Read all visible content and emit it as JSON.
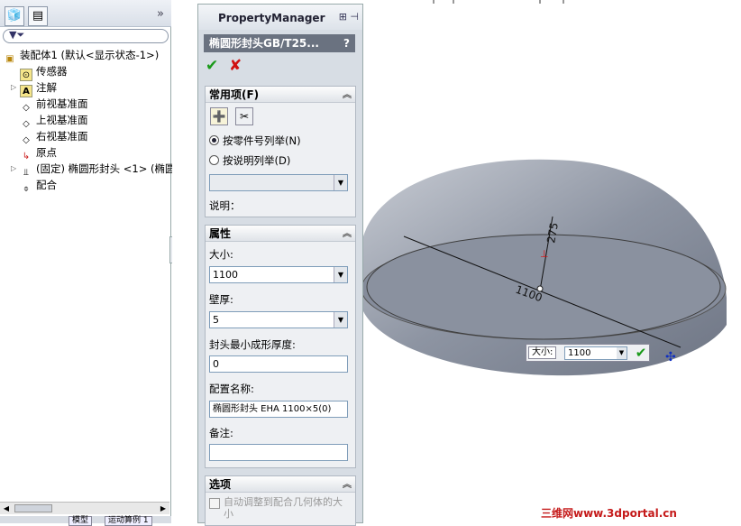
{
  "tree": {
    "filter_icon": "filter-icon",
    "collapse_label": "»",
    "items": [
      {
        "label": "装配体1 (默认<显示状态-1>)",
        "icon": "assembly-icon"
      },
      {
        "label": "传感器",
        "icon": "sensor-icon"
      },
      {
        "label": "注解",
        "icon": "annotation-icon"
      },
      {
        "label": "前视基准面",
        "icon": "plane-icon"
      },
      {
        "label": "上视基准面",
        "icon": "plane-icon"
      },
      {
        "label": "右视基准面",
        "icon": "plane-icon"
      },
      {
        "label": "原点",
        "icon": "origin-icon"
      },
      {
        "label": "(固定) 椭圆形封头 <1> (椭圆",
        "icon": "part-icon"
      },
      {
        "label": "配合",
        "icon": "mate-icon"
      }
    ],
    "bottom_tabs": [
      "模型",
      "运动算例 1"
    ]
  },
  "pm": {
    "title": "PropertyManager",
    "feature_name": "椭圆形封头GB/T25...",
    "help": "?",
    "groups": {
      "common": {
        "title": "常用项(F)",
        "radio1": "按零件号列举(N)",
        "radio2": "按说明列举(D)",
        "desc_label": "说明："
      },
      "props": {
        "title": "属性",
        "size_label": "大小:",
        "size_value": "1100",
        "thickness_label": "壁厚:",
        "thickness_value": "5",
        "min_thick_label": "封头最小成形厚度:",
        "min_thick_value": "0",
        "config_label": "配置名称:",
        "config_value": "椭圆形封头 EHA 1100×5(0)",
        "note_label": "备注:",
        "note_value": ""
      },
      "options": {
        "title": "选项",
        "auto_adjust": "自动调整到配合几何体的大小"
      }
    }
  },
  "viewport": {
    "dim_large": "1100",
    "dim_height": "275",
    "popup_label": "大小:",
    "popup_value": "1100",
    "watermark": "三维网www.3dportal.cn"
  },
  "colors": {
    "accent": "#6a7280",
    "ok": "#1a9a1a",
    "cancel": "#d01010",
    "shell": "#9aa2b0"
  }
}
